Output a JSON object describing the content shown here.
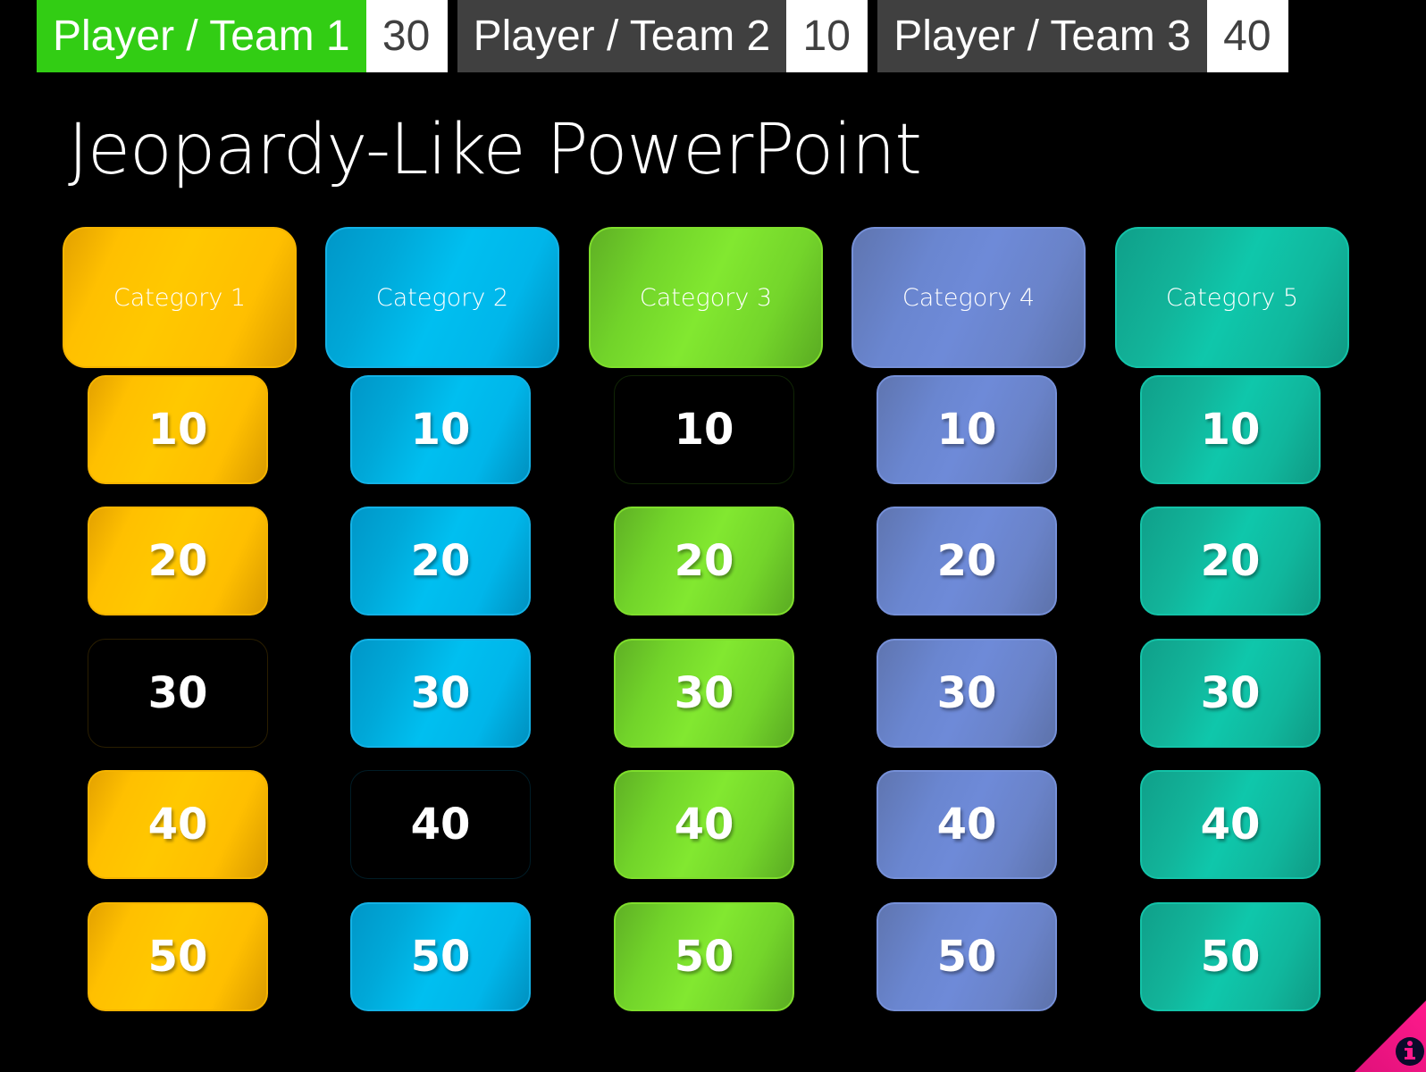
{
  "scoreboard": {
    "teams": [
      {
        "name": "Player / Team 1",
        "score": "30",
        "active": true
      },
      {
        "name": "Player / Team 2",
        "score": "10",
        "active": false
      },
      {
        "name": "Player / Team 3",
        "score": "40",
        "active": false
      }
    ]
  },
  "title": "Jeopardy-Like PowerPoint",
  "board": {
    "categories": [
      {
        "label": "Category 1",
        "theme": "yellow",
        "tiles": [
          {
            "value": "10",
            "used": false
          },
          {
            "value": "20",
            "used": false
          },
          {
            "value": "30",
            "used": true
          },
          {
            "value": "40",
            "used": false
          },
          {
            "value": "50",
            "used": false
          }
        ]
      },
      {
        "label": "Category 2",
        "theme": "blue",
        "tiles": [
          {
            "value": "10",
            "used": false
          },
          {
            "value": "20",
            "used": false
          },
          {
            "value": "30",
            "used": false
          },
          {
            "value": "40",
            "used": true
          },
          {
            "value": "50",
            "used": false
          }
        ]
      },
      {
        "label": "Category 3",
        "theme": "green",
        "tiles": [
          {
            "value": "10",
            "used": true
          },
          {
            "value": "20",
            "used": false
          },
          {
            "value": "30",
            "used": false
          },
          {
            "value": "40",
            "used": false
          },
          {
            "value": "50",
            "used": false
          }
        ]
      },
      {
        "label": "Category 4",
        "theme": "purple",
        "tiles": [
          {
            "value": "10",
            "used": false
          },
          {
            "value": "20",
            "used": false
          },
          {
            "value": "30",
            "used": false
          },
          {
            "value": "40",
            "used": false
          },
          {
            "value": "50",
            "used": false
          }
        ]
      },
      {
        "label": "Category 5",
        "theme": "teal",
        "tiles": [
          {
            "value": "10",
            "used": false
          },
          {
            "value": "20",
            "used": false
          },
          {
            "value": "30",
            "used": false
          },
          {
            "value": "40",
            "used": false
          },
          {
            "value": "50",
            "used": false
          }
        ]
      }
    ]
  },
  "colors": {
    "active_team": "#32cd14",
    "inactive_team": "#404040",
    "info_corner": "#ff1493",
    "info_icon_bg": "#0a0a2a"
  },
  "info": {
    "icon": "info-icon"
  }
}
